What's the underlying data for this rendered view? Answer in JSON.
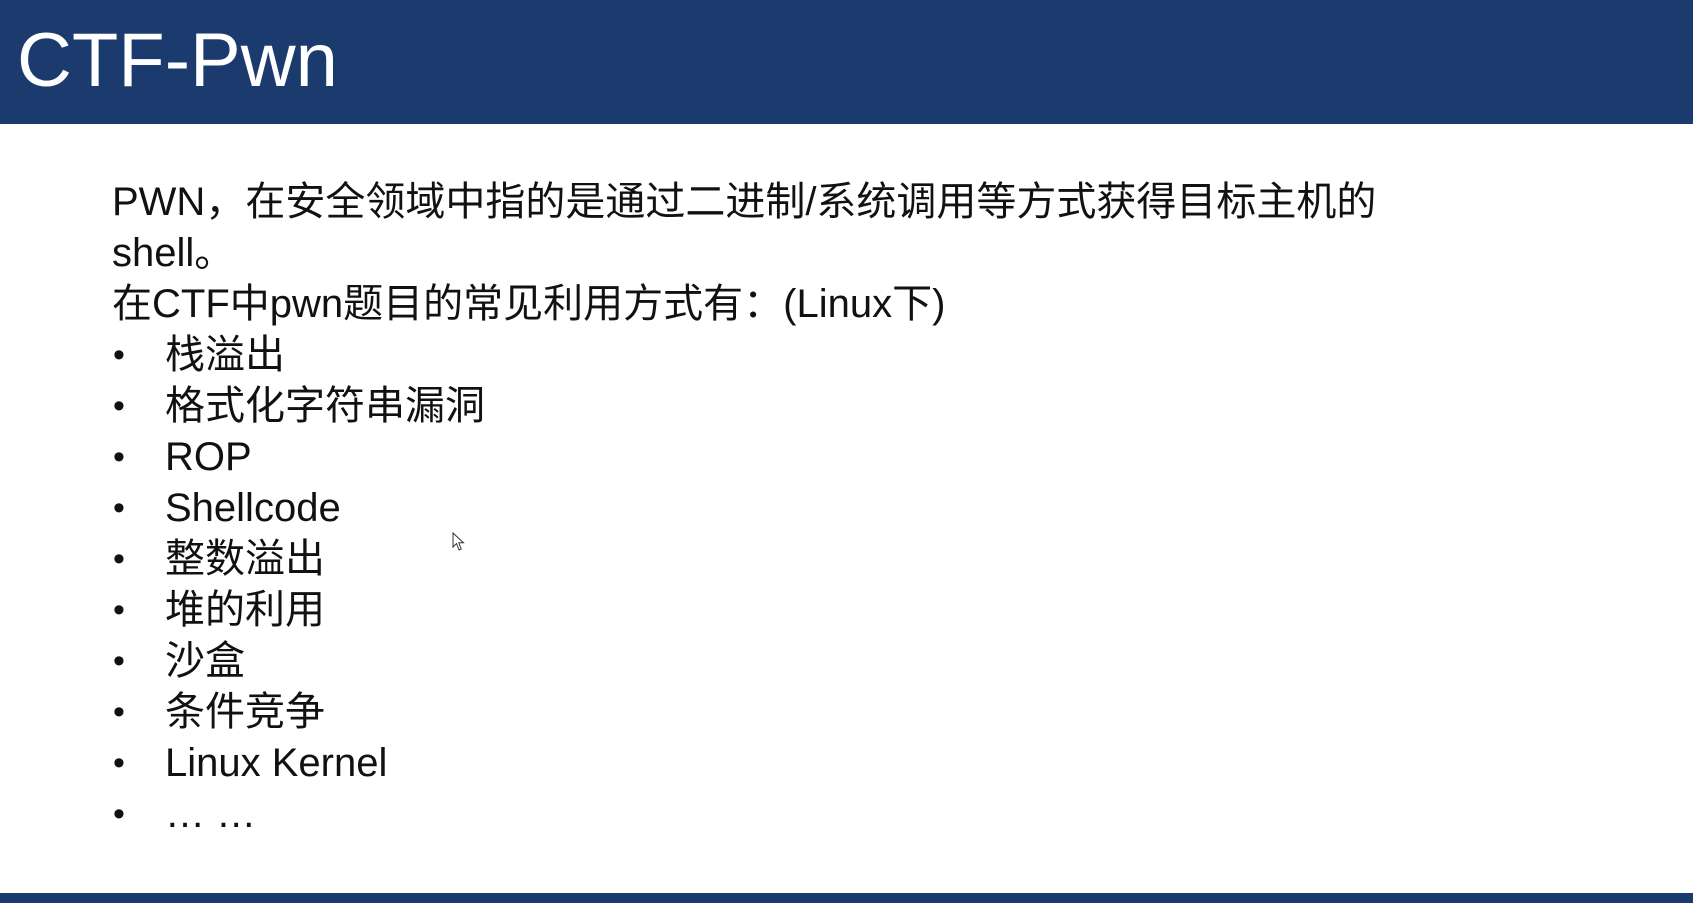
{
  "slide": {
    "title": "CTF-Pwn",
    "intro": "PWN，在安全领域中指的是通过二进制/系统调用等方式获得目标主机的shell。",
    "subheading": "在CTF中pwn题目的常见利用方式有：(Linux下)",
    "bullet_symbol": "•",
    "items": [
      "栈溢出",
      "格式化字符串漏洞",
      "ROP",
      "Shellcode",
      "整数溢出",
      "堆的利用",
      "沙盒",
      "条件竞争",
      "Linux Kernel",
      "… …"
    ]
  },
  "colors": {
    "header_bg": "#1b3a6e",
    "title_text": "#ffffff",
    "body_text": "#111111"
  },
  "icons": {
    "cursor": "mouse-pointer-icon"
  }
}
